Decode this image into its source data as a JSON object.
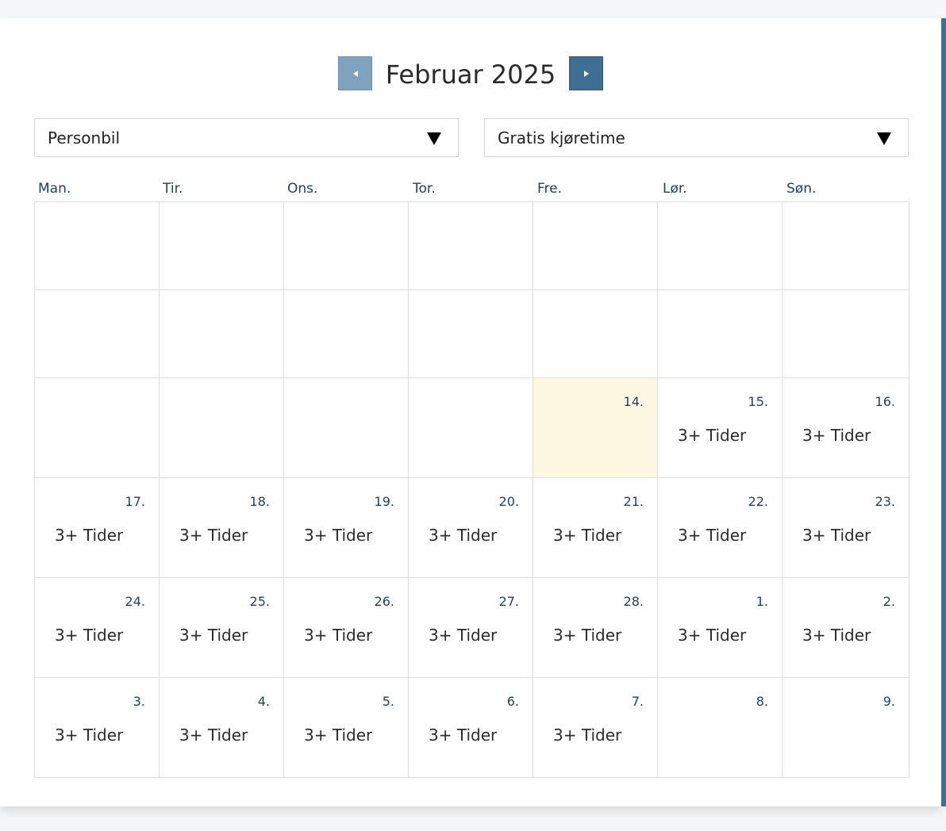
{
  "calendar": {
    "month_title": "Februar 2025",
    "prev_icon": "triangle-left-icon",
    "next_icon": "triangle-right-icon",
    "accent_color": "#3e6f93",
    "today_color": "#fef8e3",
    "filters": [
      {
        "selected": "Personbil"
      },
      {
        "selected": "Gratis kjøretime"
      }
    ],
    "weekdays": [
      "Man.",
      "Tir.",
      "Ons.",
      "Tor.",
      "Fre.",
      "Lør.",
      "Søn."
    ],
    "weeks": [
      [
        {
          "num": "",
          "slots": ""
        },
        {
          "num": "",
          "slots": ""
        },
        {
          "num": "",
          "slots": ""
        },
        {
          "num": "",
          "slots": ""
        },
        {
          "num": "",
          "slots": ""
        },
        {
          "num": "",
          "slots": ""
        },
        {
          "num": "",
          "slots": ""
        }
      ],
      [
        {
          "num": "",
          "slots": ""
        },
        {
          "num": "",
          "slots": ""
        },
        {
          "num": "",
          "slots": ""
        },
        {
          "num": "",
          "slots": ""
        },
        {
          "num": "",
          "slots": ""
        },
        {
          "num": "",
          "slots": ""
        },
        {
          "num": "",
          "slots": ""
        }
      ],
      [
        {
          "num": "",
          "slots": ""
        },
        {
          "num": "",
          "slots": ""
        },
        {
          "num": "",
          "slots": ""
        },
        {
          "num": "",
          "slots": ""
        },
        {
          "num": "14.",
          "slots": "",
          "today": true
        },
        {
          "num": "15.",
          "slots": "3+ Tider"
        },
        {
          "num": "16.",
          "slots": "3+ Tider"
        }
      ],
      [
        {
          "num": "17.",
          "slots": "3+ Tider"
        },
        {
          "num": "18.",
          "slots": "3+ Tider"
        },
        {
          "num": "19.",
          "slots": "3+ Tider"
        },
        {
          "num": "20.",
          "slots": "3+ Tider"
        },
        {
          "num": "21.",
          "slots": "3+ Tider"
        },
        {
          "num": "22.",
          "slots": "3+ Tider"
        },
        {
          "num": "23.",
          "slots": "3+ Tider"
        }
      ],
      [
        {
          "num": "24.",
          "slots": "3+ Tider"
        },
        {
          "num": "25.",
          "slots": "3+ Tider"
        },
        {
          "num": "26.",
          "slots": "3+ Tider"
        },
        {
          "num": "27.",
          "slots": "3+ Tider"
        },
        {
          "num": "28.",
          "slots": "3+ Tider"
        },
        {
          "num": "1.",
          "slots": "3+ Tider"
        },
        {
          "num": "2.",
          "slots": "3+ Tider"
        }
      ],
      [
        {
          "num": "3.",
          "slots": "3+ Tider"
        },
        {
          "num": "4.",
          "slots": "3+ Tider"
        },
        {
          "num": "5.",
          "slots": "3+ Tider"
        },
        {
          "num": "6.",
          "slots": "3+ Tider"
        },
        {
          "num": "7.",
          "slots": "3+ Tider"
        },
        {
          "num": "8.",
          "slots": ""
        },
        {
          "num": "9.",
          "slots": ""
        }
      ]
    ]
  }
}
